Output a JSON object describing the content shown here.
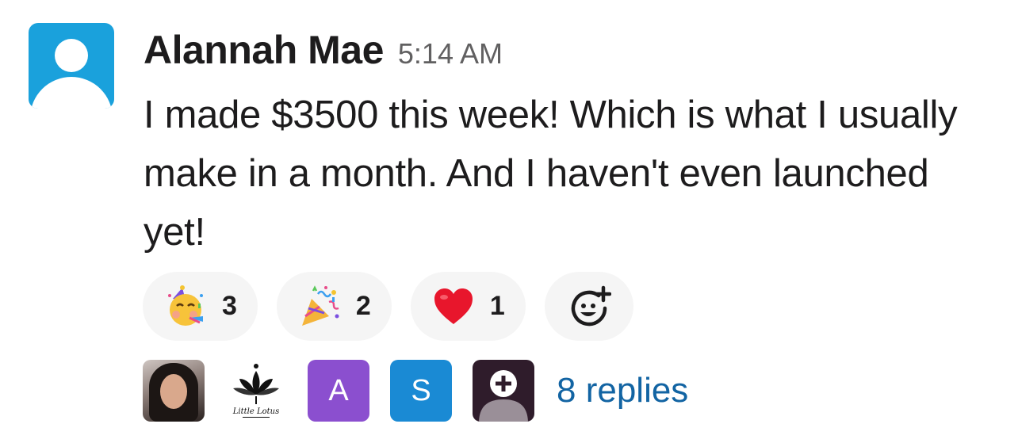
{
  "message": {
    "author": "Alannah Mae",
    "time": "5:14 AM",
    "text": "I made $3500 this week! Which is what I usually make in a month. And I haven't even launched yet!"
  },
  "reactions": [
    {
      "emoji": "partying-face",
      "count": "3"
    },
    {
      "emoji": "party-popper",
      "count": "2"
    },
    {
      "emoji": "red-heart",
      "count": "1"
    }
  ],
  "add_reaction": {
    "icon": "add-reaction-icon"
  },
  "thread": {
    "participants": [
      {
        "type": "photo"
      },
      {
        "type": "logo",
        "text": "Little Lotus"
      },
      {
        "type": "letter",
        "letter": "A",
        "color": "#8b4fcf"
      },
      {
        "type": "letter",
        "letter": "S",
        "color": "#1a8ad4"
      },
      {
        "type": "default-avatar",
        "color": "#2f1c2b"
      }
    ],
    "replies_label": "8 replies"
  },
  "colors": {
    "avatar_bg": "#1aa1dc",
    "reaction_bg": "#f5f5f5",
    "link": "#1264a3",
    "timestamp": "#616061"
  }
}
